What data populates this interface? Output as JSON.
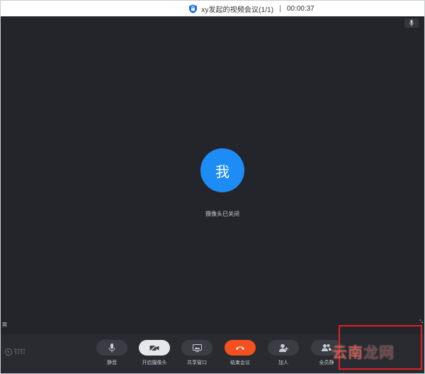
{
  "titlebar": {
    "title": "xy发起的视频会议(1/1)",
    "separator": "|",
    "timer": "00:00:37"
  },
  "stage": {
    "avatar_text": "我",
    "camera_status": "摄像头已关闭",
    "corner_left": "冥",
    "corner_right": "⤡"
  },
  "toolbar": {
    "brand": "钉钉",
    "buttons": [
      {
        "label": "静音",
        "icon": "microphone-icon"
      },
      {
        "label": "开启摄像头",
        "icon": "camera-off-icon"
      },
      {
        "label": "共享窗口",
        "icon": "share-screen-icon"
      },
      {
        "label": "结束会议",
        "icon": "hang-up-icon"
      },
      {
        "label": "加人",
        "icon": "add-person-icon"
      },
      {
        "label": "全员静",
        "icon": "mute-all-icon"
      }
    ]
  },
  "watermark": {
    "text_a": "云南",
    "text_b": "龙网"
  },
  "colors": {
    "background": "#23252b",
    "toolbar": "#292b31",
    "avatar": "#1e8cf5",
    "end_call": "#f4511e",
    "highlight": "#e02020"
  }
}
